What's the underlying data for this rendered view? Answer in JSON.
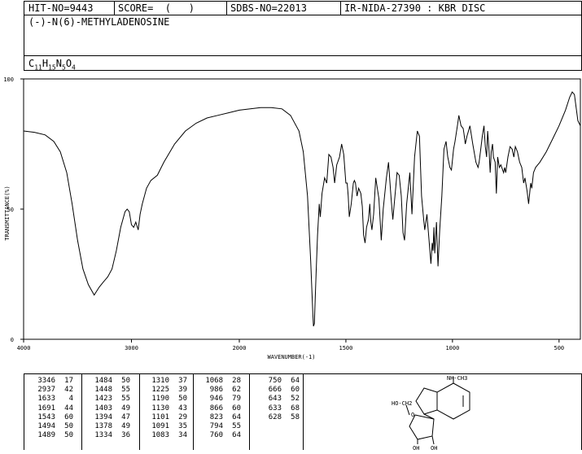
{
  "header": {
    "hit_no": "HIT-NO=9443",
    "score": "SCORE=  (   )",
    "sdbs_no": "SDBS-NO=22013",
    "ir_info": "IR-NIDA-27390 : KBR DISC"
  },
  "compound": {
    "name": "(-)-N(6)-METHYLADENOSINE",
    "formula_parts": [
      {
        "t": "C",
        "sub": false
      },
      {
        "t": "11",
        "sub": true
      },
      {
        "t": "H",
        "sub": false
      },
      {
        "t": "15",
        "sub": true
      },
      {
        "t": "N",
        "sub": false
      },
      {
        "t": "5",
        "sub": true
      },
      {
        "t": "O",
        "sub": false
      },
      {
        "t": "4",
        "sub": true
      }
    ]
  },
  "chart_data": {
    "type": "line",
    "xlabel": "WAVENUMBER(-1)",
    "ylabel": "TRANSMITTANCE(%)",
    "xlim": [
      4000,
      400
    ],
    "ylim": [
      0,
      100
    ],
    "x_ticks": [
      4000,
      3000,
      2000,
      1500,
      1000,
      500
    ],
    "y_ticks": [
      0,
      50,
      100
    ],
    "series": [
      {
        "color": "#000000",
        "points": [
          [
            4000,
            80
          ],
          [
            3900,
            79.5
          ],
          [
            3800,
            78.5
          ],
          [
            3720,
            76
          ],
          [
            3660,
            72
          ],
          [
            3600,
            64
          ],
          [
            3550,
            52
          ],
          [
            3500,
            38
          ],
          [
            3450,
            27
          ],
          [
            3400,
            21
          ],
          [
            3346,
            17
          ],
          [
            3300,
            20
          ],
          [
            3260,
            22
          ],
          [
            3220,
            24
          ],
          [
            3180,
            27
          ],
          [
            3140,
            34
          ],
          [
            3100,
            43
          ],
          [
            3060,
            49
          ],
          [
            3040,
            50
          ],
          [
            3020,
            49
          ],
          [
            3000,
            44
          ],
          [
            2980,
            43
          ],
          [
            2960,
            45
          ],
          [
            2937,
            42
          ],
          [
            2920,
            48
          ],
          [
            2900,
            52
          ],
          [
            2860,
            58
          ],
          [
            2820,
            61
          ],
          [
            2760,
            63
          ],
          [
            2700,
            68
          ],
          [
            2600,
            75
          ],
          [
            2500,
            80
          ],
          [
            2400,
            83
          ],
          [
            2300,
            85
          ],
          [
            2200,
            86
          ],
          [
            2100,
            87
          ],
          [
            2000,
            88
          ],
          [
            1900,
            89
          ],
          [
            1850,
            89
          ],
          [
            1800,
            88.5
          ],
          [
            1760,
            86
          ],
          [
            1720,
            80
          ],
          [
            1700,
            72
          ],
          [
            1680,
            55
          ],
          [
            1665,
            30
          ],
          [
            1655,
            10
          ],
          [
            1652,
            5
          ],
          [
            1648,
            6
          ],
          [
            1640,
            25
          ],
          [
            1633,
            40
          ],
          [
            1625,
            52
          ],
          [
            1620,
            47
          ],
          [
            1612,
            56
          ],
          [
            1600,
            62
          ],
          [
            1590,
            60
          ],
          [
            1580,
            71
          ],
          [
            1570,
            70
          ],
          [
            1560,
            66
          ],
          [
            1553,
            60
          ],
          [
            1543,
            67
          ],
          [
            1530,
            70
          ],
          [
            1520,
            75
          ],
          [
            1510,
            71
          ],
          [
            1500,
            60
          ],
          [
            1494,
            60
          ],
          [
            1489,
            55
          ],
          [
            1484,
            47
          ],
          [
            1475,
            52
          ],
          [
            1465,
            60
          ],
          [
            1460,
            61
          ],
          [
            1455,
            60
          ],
          [
            1448,
            55
          ],
          [
            1440,
            58
          ],
          [
            1430,
            56
          ],
          [
            1423,
            51
          ],
          [
            1417,
            40
          ],
          [
            1410,
            37
          ],
          [
            1403,
            43
          ],
          [
            1394,
            46
          ],
          [
            1388,
            52
          ],
          [
            1383,
            45
          ],
          [
            1378,
            42
          ],
          [
            1370,
            48
          ],
          [
            1360,
            62
          ],
          [
            1345,
            54
          ],
          [
            1334,
            38
          ],
          [
            1325,
            50
          ],
          [
            1310,
            62
          ],
          [
            1300,
            68
          ],
          [
            1288,
            54
          ],
          [
            1280,
            46
          ],
          [
            1270,
            55
          ],
          [
            1260,
            64
          ],
          [
            1250,
            63
          ],
          [
            1240,
            55
          ],
          [
            1232,
            41
          ],
          [
            1225,
            38
          ],
          [
            1215,
            52
          ],
          [
            1200,
            64
          ],
          [
            1190,
            48
          ],
          [
            1178,
            70
          ],
          [
            1165,
            80
          ],
          [
            1155,
            78
          ],
          [
            1145,
            55
          ],
          [
            1135,
            46
          ],
          [
            1130,
            42
          ],
          [
            1120,
            48
          ],
          [
            1110,
            38
          ],
          [
            1101,
            29
          ],
          [
            1095,
            37
          ],
          [
            1091,
            34
          ],
          [
            1087,
            43
          ],
          [
            1083,
            33
          ],
          [
            1075,
            45
          ],
          [
            1068,
            28
          ],
          [
            1060,
            42
          ],
          [
            1050,
            55
          ],
          [
            1040,
            73
          ],
          [
            1030,
            76
          ],
          [
            1022,
            70
          ],
          [
            1012,
            66
          ],
          [
            1005,
            65
          ],
          [
            995,
            73
          ],
          [
            988,
            76
          ],
          [
            975,
            83
          ],
          [
            970,
            86
          ],
          [
            960,
            82
          ],
          [
            950,
            81
          ],
          [
            946,
            79
          ],
          [
            940,
            75
          ],
          [
            932,
            78
          ],
          [
            925,
            80
          ],
          [
            918,
            82
          ],
          [
            905,
            75
          ],
          [
            890,
            68
          ],
          [
            880,
            66
          ],
          [
            875,
            68
          ],
          [
            866,
            74
          ],
          [
            860,
            78
          ],
          [
            852,
            82
          ],
          [
            846,
            74
          ],
          [
            840,
            70
          ],
          [
            835,
            80
          ],
          [
            828,
            72
          ],
          [
            823,
            64
          ],
          [
            818,
            72
          ],
          [
            812,
            75
          ],
          [
            808,
            70
          ],
          [
            800,
            68
          ],
          [
            794,
            56
          ],
          [
            788,
            70
          ],
          [
            780,
            66
          ],
          [
            773,
            67
          ],
          [
            760,
            64
          ],
          [
            755,
            66
          ],
          [
            750,
            64
          ],
          [
            740,
            70
          ],
          [
            730,
            74
          ],
          [
            720,
            73
          ],
          [
            712,
            70
          ],
          [
            705,
            74
          ],
          [
            695,
            72
          ],
          [
            685,
            68
          ],
          [
            675,
            66
          ],
          [
            666,
            60
          ],
          [
            660,
            62
          ],
          [
            650,
            57
          ],
          [
            643,
            52
          ],
          [
            638,
            56
          ],
          [
            633,
            60
          ],
          [
            628,
            58
          ],
          [
            620,
            64
          ],
          [
            610,
            66
          ],
          [
            590,
            68
          ],
          [
            560,
            72
          ],
          [
            530,
            77
          ],
          [
            500,
            82
          ],
          [
            470,
            88
          ],
          [
            450,
            93
          ],
          [
            438,
            95
          ],
          [
            428,
            94
          ],
          [
            420,
            89
          ],
          [
            412,
            84
          ],
          [
            400,
            82
          ]
        ]
      }
    ]
  },
  "peak_table": {
    "columns": [
      [
        [
          "3346",
          "17"
        ],
        [
          "2937",
          "42"
        ],
        [
          "1633",
          "4"
        ],
        [
          "1691",
          "44"
        ],
        [
          "1543",
          "60"
        ],
        [
          "1494",
          "50"
        ],
        [
          "1489",
          "50"
        ]
      ],
      [
        [
          "1484",
          "50"
        ],
        [
          "1448",
          "55"
        ],
        [
          "1423",
          "55"
        ],
        [
          "1403",
          "49"
        ],
        [
          "1394",
          "47"
        ],
        [
          "1378",
          "49"
        ],
        [
          "1334",
          "36"
        ]
      ],
      [
        [
          "1310",
          "37"
        ],
        [
          "1225",
          "39"
        ],
        [
          "1190",
          "50"
        ],
        [
          "1130",
          "43"
        ],
        [
          "1101",
          "29"
        ],
        [
          "1091",
          "35"
        ],
        [
          "1083",
          "34"
        ]
      ],
      [
        [
          "1068",
          "28"
        ],
        [
          "986",
          "62"
        ],
        [
          "946",
          "79"
        ],
        [
          "866",
          "60"
        ],
        [
          "823",
          "64"
        ],
        [
          "794",
          "55"
        ],
        [
          "760",
          "64"
        ]
      ],
      [
        [
          "750",
          "64"
        ],
        [
          "666",
          "60"
        ],
        [
          "643",
          "52"
        ],
        [
          "633",
          "68"
        ],
        [
          "628",
          "58"
        ]
      ]
    ]
  },
  "structure": {
    "substituent": "NH-CH3",
    "hydroxymethyl": "HO-CH2",
    "ring_oxygen": "O",
    "hydroxyl_left": "OH",
    "hydroxyl_right": "OH"
  }
}
